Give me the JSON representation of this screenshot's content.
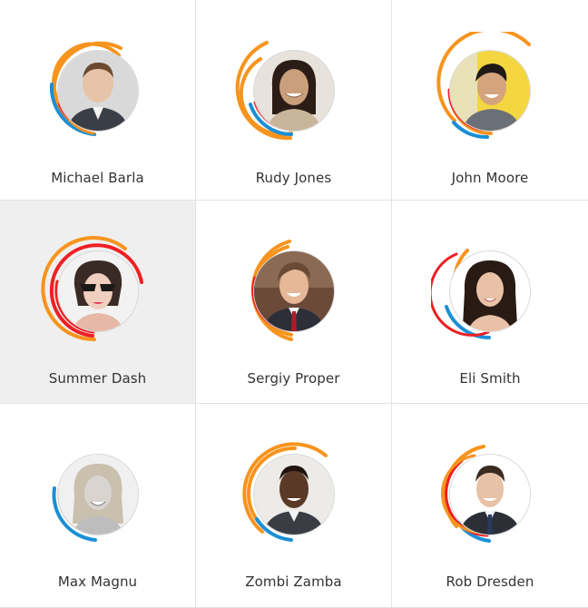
{
  "colors": {
    "orange": "#f7941d",
    "red": "#ed2024",
    "blue": "#1b8fd6",
    "border": "#e3e3e3",
    "active_bg": "#efefef"
  },
  "people": [
    {
      "name": "Michael Barla",
      "selected": false,
      "avatar": "man-short-brown-hair-suit"
    },
    {
      "name": "Rudy Jones",
      "selected": false,
      "avatar": "woman-dark-hair-smiling"
    },
    {
      "name": "John Moore",
      "selected": false,
      "avatar": "man-dark-hair-smiling"
    },
    {
      "name": "Summer Dash",
      "selected": true,
      "avatar": "woman-sunglasses-dark-hair"
    },
    {
      "name": "Sergiy Proper",
      "selected": false,
      "avatar": "man-suit-tie-smiling"
    },
    {
      "name": "Eli Smith",
      "selected": false,
      "avatar": "woman-long-dark-hair"
    },
    {
      "name": "Max Magnu",
      "selected": false,
      "avatar": "woman-blonde-grayscale"
    },
    {
      "name": "Zombi Zamba",
      "selected": false,
      "avatar": "man-dark-skin-suit"
    },
    {
      "name": "Rob Dresden",
      "selected": false,
      "avatar": "man-short-hair-suit"
    }
  ]
}
